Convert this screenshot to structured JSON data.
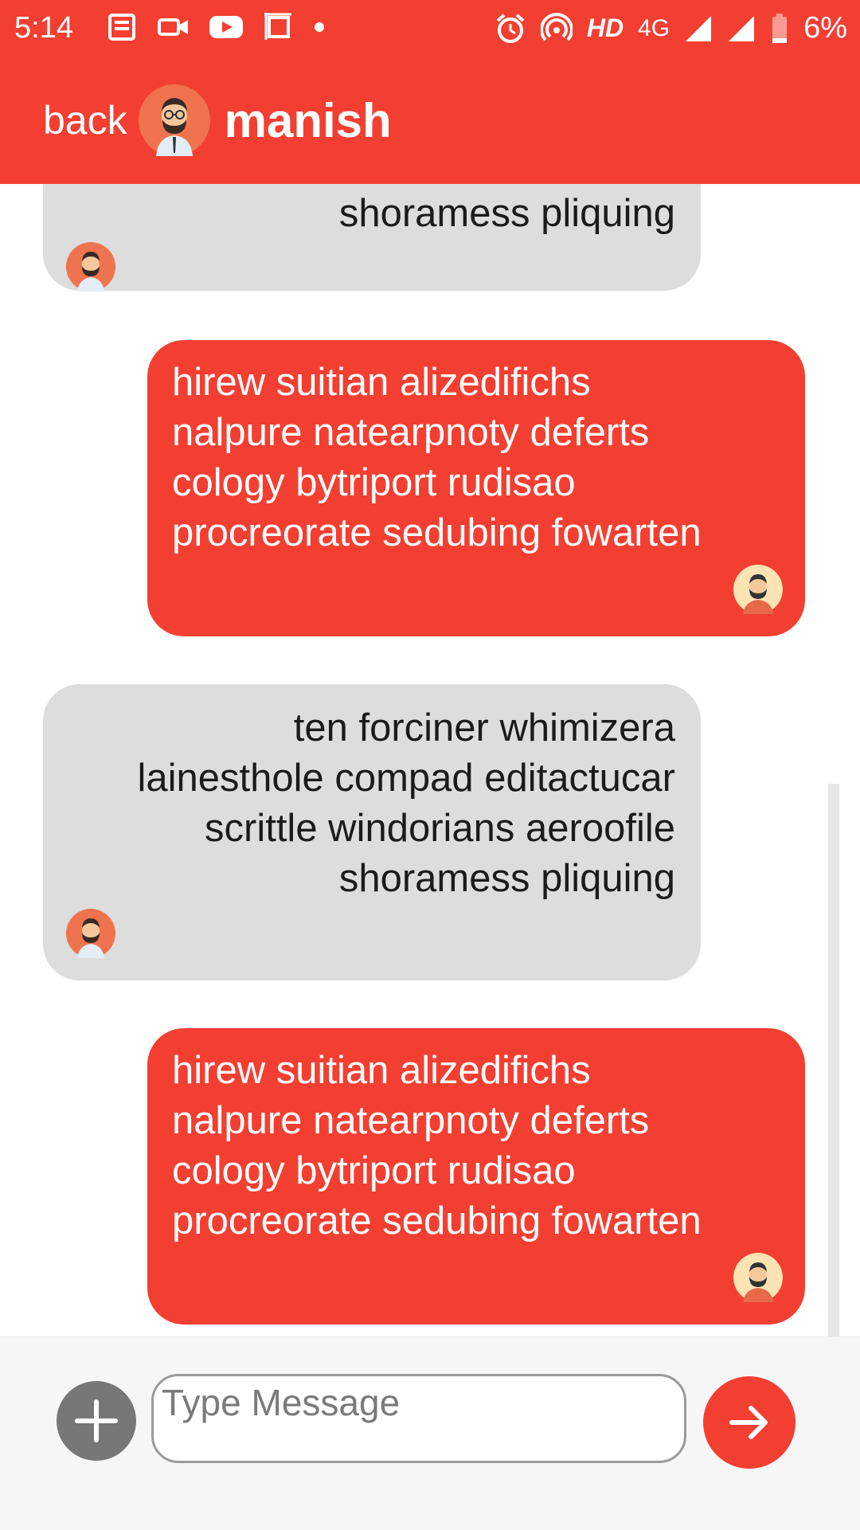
{
  "status_bar": {
    "time": "5:14",
    "network": "HD",
    "network_type": "4G",
    "battery": "6%"
  },
  "header": {
    "back_label": "back",
    "contact_name": "manish"
  },
  "messages": [
    {
      "from": "contact",
      "text": "shoramess pliquing"
    },
    {
      "from": "me",
      "text": "hirew suitian alizedifichs\nnalpure natearpnoty deferts\ncology bytriport rudisao\nprocreorate sedubing fowarten"
    },
    {
      "from": "contact",
      "text": "ten forciner whimizera\nlainesthole compad editactucar\nscrittle windorians aeroofile\nshoramess pliquing"
    },
    {
      "from": "me",
      "text": "hirew suitian alizedifichs\nnalpure natearpnoty deferts\ncology bytriport rudisao\nprocreorate sedubing fowarten"
    }
  ],
  "composer": {
    "placeholder": "Type Message",
    "value": ""
  },
  "colors": {
    "accent": "#f33f32",
    "received_bubble": "#dddddd",
    "plus_button": "#777777"
  },
  "icons": {
    "add": "plus-icon",
    "send": "arrow-right-icon"
  }
}
